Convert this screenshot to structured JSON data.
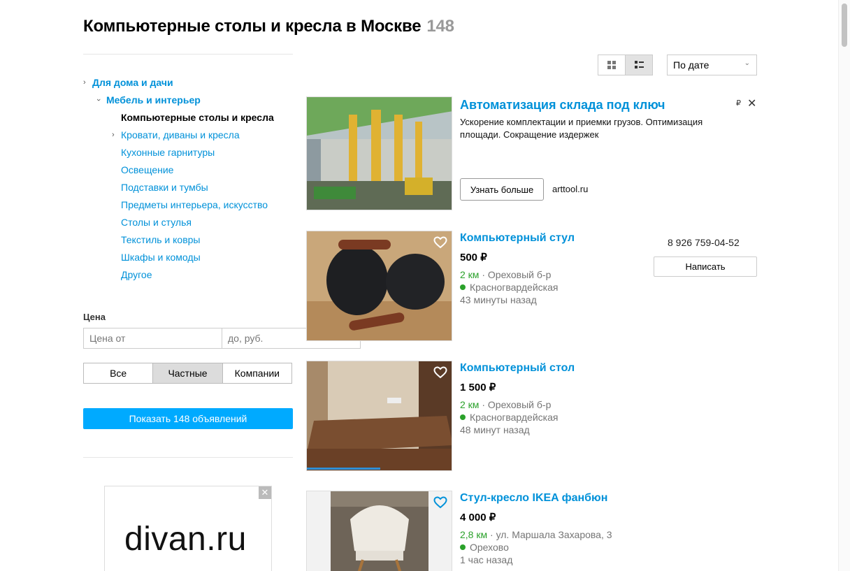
{
  "header": {
    "title": "Компьютерные столы и кресла в Москве",
    "count": "148"
  },
  "categories": {
    "root": "Для дома и дачи",
    "parent": "Мебель и интерьер",
    "current": "Компьютерные столы и кресла",
    "items": [
      "Кровати, диваны и кресла",
      "Кухонные гарнитуры",
      "Освещение",
      "Подставки и тумбы",
      "Предметы интерьера, искусство",
      "Столы и стулья",
      "Текстиль и ковры",
      "Шкафы и комоды",
      "Другое"
    ]
  },
  "filters": {
    "price_label": "Цена",
    "price_from_placeholder": "Цена от",
    "price_to_placeholder": "до, руб.",
    "seller_types": [
      "Все",
      "Частные",
      "Компании"
    ],
    "selected_seller": "Частные",
    "show_button": "Показать 148 объявлений"
  },
  "side_ad": {
    "logo": "divan.ru",
    "close": "✕"
  },
  "toolbar": {
    "sort_value": "По дате",
    "view_mode": "list"
  },
  "ad": {
    "title": "Автоматизация склада под ключ",
    "text": "Ускорение комплектации и приемки грузов. Оптимизация площади. Сокращение издержек",
    "button": "Узнать больше",
    "domain": "arttool.ru",
    "badge": "₽",
    "close": "✕"
  },
  "listings": [
    {
      "title": "Компьютерный стул",
      "price": "500 ₽",
      "distance": "2 км",
      "address": "Ореховый б-р",
      "metro": "Красногвардейская",
      "time": "43 минуты назад",
      "phone": "8 926 759-04-52",
      "write": "Написать"
    },
    {
      "title": "Компьютерный стол",
      "price": "1 500 ₽",
      "distance": "2 км",
      "address": "Ореховый б-р",
      "metro": "Красногвардейская",
      "time": "48 минут назад"
    },
    {
      "title": "Стул-кресло IKEA фанбюн",
      "price": "4 000 ₽",
      "distance": "2,8 км",
      "address": "ул. Маршала Захарова, 3",
      "metro": "Орехово",
      "time": "1 час назад"
    }
  ],
  "colors": {
    "link": "#0091d9",
    "button": "#00aaff",
    "metro": "#2aa12a"
  }
}
